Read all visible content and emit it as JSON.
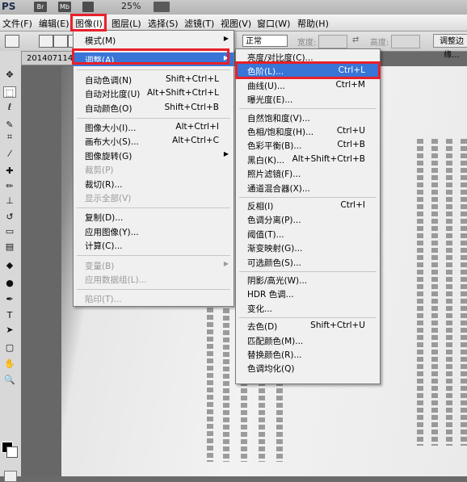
{
  "app": {
    "logo": "PS",
    "chips": [
      "Br",
      "Mb"
    ],
    "zoom": "25%"
  },
  "menubar": [
    {
      "label": "文件(F)"
    },
    {
      "label": "编辑(E)"
    },
    {
      "label": "图像(I)"
    },
    {
      "label": "图层(L)"
    },
    {
      "label": "选择(S)"
    },
    {
      "label": "滤镜(T)"
    },
    {
      "label": "视图(V)"
    },
    {
      "label": "窗口(W)"
    },
    {
      "label": "帮助(H)"
    }
  ],
  "options": {
    "mode": "正常",
    "width_label": "宽度:",
    "height_label": "高度:",
    "refine_button": "调整边缘..."
  },
  "document": {
    "tab": "201407114"
  },
  "image_menu": [
    {
      "label": "模式(M)",
      "submenu": true
    },
    {
      "sep": true
    },
    {
      "label": "调整(A)",
      "submenu": true,
      "hl": true
    },
    {
      "sep": true
    },
    {
      "label": "自动色调(N)",
      "shortcut": "Shift+Ctrl+L"
    },
    {
      "label": "自动对比度(U)",
      "shortcut": "Alt+Shift+Ctrl+L"
    },
    {
      "label": "自动颜色(O)",
      "shortcut": "Shift+Ctrl+B"
    },
    {
      "sep": true
    },
    {
      "label": "图像大小(I)...",
      "shortcut": "Alt+Ctrl+I"
    },
    {
      "label": "画布大小(S)...",
      "shortcut": "Alt+Ctrl+C"
    },
    {
      "label": "图像旋转(G)",
      "submenu": true
    },
    {
      "label": "裁剪(P)",
      "disabled": true
    },
    {
      "label": "裁切(R)..."
    },
    {
      "label": "显示全部(V)",
      "disabled": true
    },
    {
      "sep": true
    },
    {
      "label": "复制(D)..."
    },
    {
      "label": "应用图像(Y)..."
    },
    {
      "label": "计算(C)..."
    },
    {
      "sep": true
    },
    {
      "label": "变量(B)",
      "submenu": true,
      "disabled": true
    },
    {
      "label": "应用数据组(L)...",
      "disabled": true
    },
    {
      "sep": true
    },
    {
      "label": "陷印(T)...",
      "disabled": true
    }
  ],
  "adjust_menu": [
    {
      "label": "亮度/对比度(C)..."
    },
    {
      "label": "色阶(L)...",
      "shortcut": "Ctrl+L",
      "hl": true
    },
    {
      "label": "曲线(U)...",
      "shortcut": "Ctrl+M"
    },
    {
      "label": "曝光度(E)..."
    },
    {
      "sep": true
    },
    {
      "label": "自然饱和度(V)..."
    },
    {
      "label": "色相/饱和度(H)...",
      "shortcut": "Ctrl+U"
    },
    {
      "label": "色彩平衡(B)...",
      "shortcut": "Ctrl+B"
    },
    {
      "label": "黑白(K)...",
      "shortcut": "Alt+Shift+Ctrl+B"
    },
    {
      "label": "照片滤镜(F)..."
    },
    {
      "label": "通道混合器(X)..."
    },
    {
      "sep": true
    },
    {
      "label": "反相(I)",
      "shortcut": "Ctrl+I"
    },
    {
      "label": "色调分离(P)..."
    },
    {
      "label": "阈值(T)..."
    },
    {
      "label": "渐变映射(G)..."
    },
    {
      "label": "可选颜色(S)..."
    },
    {
      "sep": true
    },
    {
      "label": "阴影/高光(W)..."
    },
    {
      "label": "HDR 色调..."
    },
    {
      "label": "变化..."
    },
    {
      "sep": true
    },
    {
      "label": "去色(D)",
      "shortcut": "Shift+Ctrl+U"
    },
    {
      "label": "匹配颜色(M)..."
    },
    {
      "label": "替换颜色(R)..."
    },
    {
      "label": "色调均化(Q)"
    }
  ],
  "toolbox": [
    {
      "name": "move-tool-icon",
      "glyph": "✥"
    },
    {
      "name": "marquee-tool-icon",
      "glyph": "⬚"
    },
    {
      "name": "lasso-tool-icon",
      "glyph": "ℓ"
    },
    {
      "name": "quick-select-tool-icon",
      "glyph": "✎"
    },
    {
      "name": "crop-tool-icon",
      "glyph": "⌗"
    },
    {
      "name": "eyedropper-tool-icon",
      "glyph": "⁄"
    },
    {
      "name": "healing-brush-tool-icon",
      "glyph": "✚"
    },
    {
      "name": "brush-tool-icon",
      "glyph": "✏"
    },
    {
      "name": "stamp-tool-icon",
      "glyph": "⊥"
    },
    {
      "name": "history-brush-tool-icon",
      "glyph": "↺"
    },
    {
      "name": "eraser-tool-icon",
      "glyph": "▭"
    },
    {
      "name": "gradient-tool-icon",
      "glyph": "▤"
    },
    {
      "name": "blur-tool-icon",
      "glyph": "◆"
    },
    {
      "name": "dodge-tool-icon",
      "glyph": "●"
    },
    {
      "name": "pen-tool-icon",
      "glyph": "✒"
    },
    {
      "name": "type-tool-icon",
      "glyph": "T"
    },
    {
      "name": "path-select-tool-icon",
      "glyph": "➤"
    },
    {
      "name": "shape-tool-icon",
      "glyph": "▢"
    },
    {
      "name": "hand-tool-icon",
      "glyph": "✋"
    },
    {
      "name": "zoom-tool-icon",
      "glyph": "🔍"
    }
  ],
  "colors": {
    "highlight": "#3875d7",
    "callout": "#e8202a"
  }
}
